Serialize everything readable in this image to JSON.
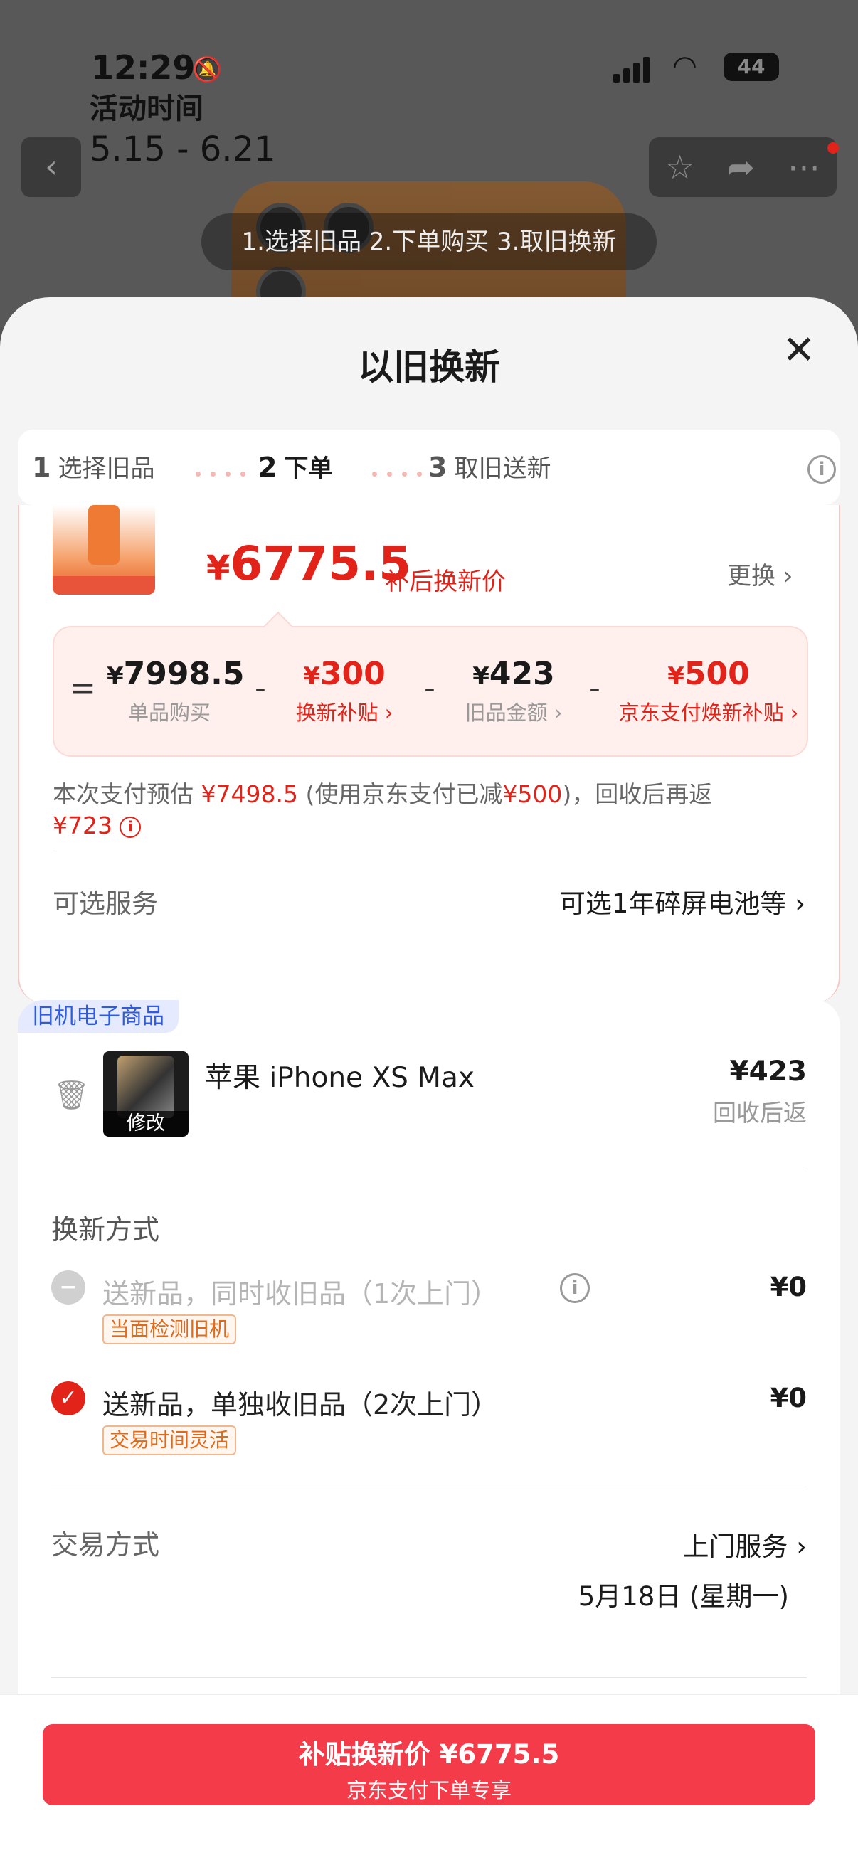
{
  "status_bar": {
    "time": "12:29",
    "battery": "44"
  },
  "background": {
    "activity_label": "活动时间",
    "activity_dates": "5.15 - 6.21",
    "steps_banner": "1.选择旧品 2.下单购买 3.取旧换新"
  },
  "sheet": {
    "title": "以旧换新"
  },
  "progress": [
    {
      "num": "1",
      "label": "选择旧品"
    },
    {
      "num": "2",
      "label": "下单"
    },
    {
      "num": "3",
      "label": "取旧送新"
    }
  ],
  "product": {
    "price_yen": "¥",
    "price": "6775.5",
    "price_note": "补后换新价",
    "change_label": "更换 ›"
  },
  "formula": {
    "eq": "=",
    "minus": "-",
    "items": [
      {
        "value": "7998.5",
        "label": "单品购买"
      },
      {
        "value": "300",
        "label": "换新补贴 ›"
      },
      {
        "value": "423",
        "label": "旧品金额 ›"
      },
      {
        "value": "500",
        "label": "京东支付焕新补贴 ›"
      }
    ]
  },
  "payment": {
    "text1": "本次支付预估",
    "amount1": "¥7498.5",
    "text2": "(使用京东支付已减",
    "amount2": "¥500",
    "text3": ")，回收后再返",
    "amount3": "¥723"
  },
  "optional_service": {
    "label": "可选服务",
    "value": "可选1年碎屏电池等 ›"
  },
  "old_item": {
    "tag": "旧机电子商品",
    "edit_label": "修改",
    "name": "苹果 iPhone XS Max",
    "price": "¥423",
    "note": "回收后返"
  },
  "renew": {
    "title": "换新方式",
    "options": [
      {
        "text": "送新品，同时收旧品（1次上门）",
        "tag": "当面检测旧机",
        "price": "¥0",
        "selected": false
      },
      {
        "text": "送新品，单独收旧品（2次上门）",
        "tag": "交易时间灵活",
        "price": "¥0",
        "selected": true
      }
    ]
  },
  "trade": {
    "label": "交易方式",
    "value": "上门服务 ›",
    "date": "5月18日 (星期一)"
  },
  "cta": {
    "title": "补贴换新价 ¥6775.5",
    "subtitle": "京东支付下单专享"
  },
  "colors": {
    "accent": "#e2231a",
    "cta": "#f43b4a",
    "formula_bg": "#fff0ee"
  }
}
